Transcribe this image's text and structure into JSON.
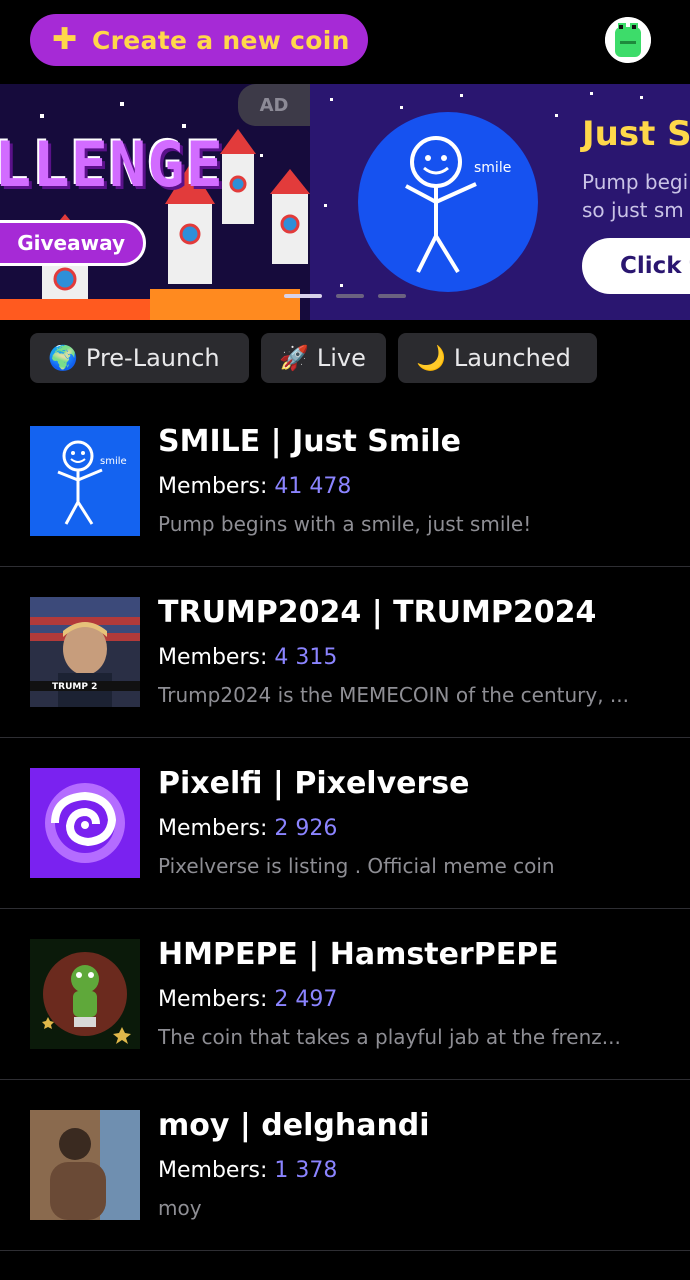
{
  "header": {
    "create_label": "Create a new coin",
    "plus_icon": "plus-icon",
    "avatar_icon": "pepe-avatar-icon"
  },
  "banner": {
    "ad_label": "AD",
    "left_slide": {
      "title": "LLENGE",
      "button_label": "Giveaway"
    },
    "right_slide": {
      "logo_text": "smile",
      "title": "Just S",
      "text_line1": "Pump begi",
      "text_line2": "so just sm",
      "button_label": "Click t"
    },
    "slide_count": 3,
    "active_slide": 0
  },
  "filters": [
    {
      "icon": "globe-emoji",
      "emoji": "🌍",
      "label": "Pre-Launch"
    },
    {
      "icon": "rocket-emoji",
      "emoji": "🚀",
      "label": "Live"
    },
    {
      "icon": "moon-emoji",
      "emoji": "🌙",
      "label": "Launched"
    }
  ],
  "members_label": "Members:",
  "coins": [
    {
      "name": "SMILE | Just Smile",
      "members": "41 478",
      "description": "Pump begins with a smile, just smile!",
      "thumb": "smile-stickman",
      "thumb_text": "smile"
    },
    {
      "name": "TRUMP2024 | TRUMP2024",
      "members": "4 315",
      "description": "Trump2024 is the MEMECOIN of the century, ...",
      "thumb": "trump-poster",
      "thumb_text": "TRUMP 2"
    },
    {
      "name": "Pixelfi | Pixelverse",
      "members": "2 926",
      "description": "Pixelverse is listing . Official meme coin",
      "thumb": "pixel-swirl"
    },
    {
      "name": "HMPEPE | HamsterPEPE",
      "members": "2 497",
      "description": "The coin that takes a playful jab at the frenz...",
      "thumb": "hamster-pepe"
    },
    {
      "name": "moy | delghandi",
      "members": "1 378",
      "description": "moy",
      "thumb": "photo-placeholder"
    }
  ],
  "colors": {
    "accent_purple": "#a62ad6",
    "accent_yellow": "#ffd84a",
    "member_count": "#8b84ff",
    "chip_bg": "#2b2b2f"
  }
}
